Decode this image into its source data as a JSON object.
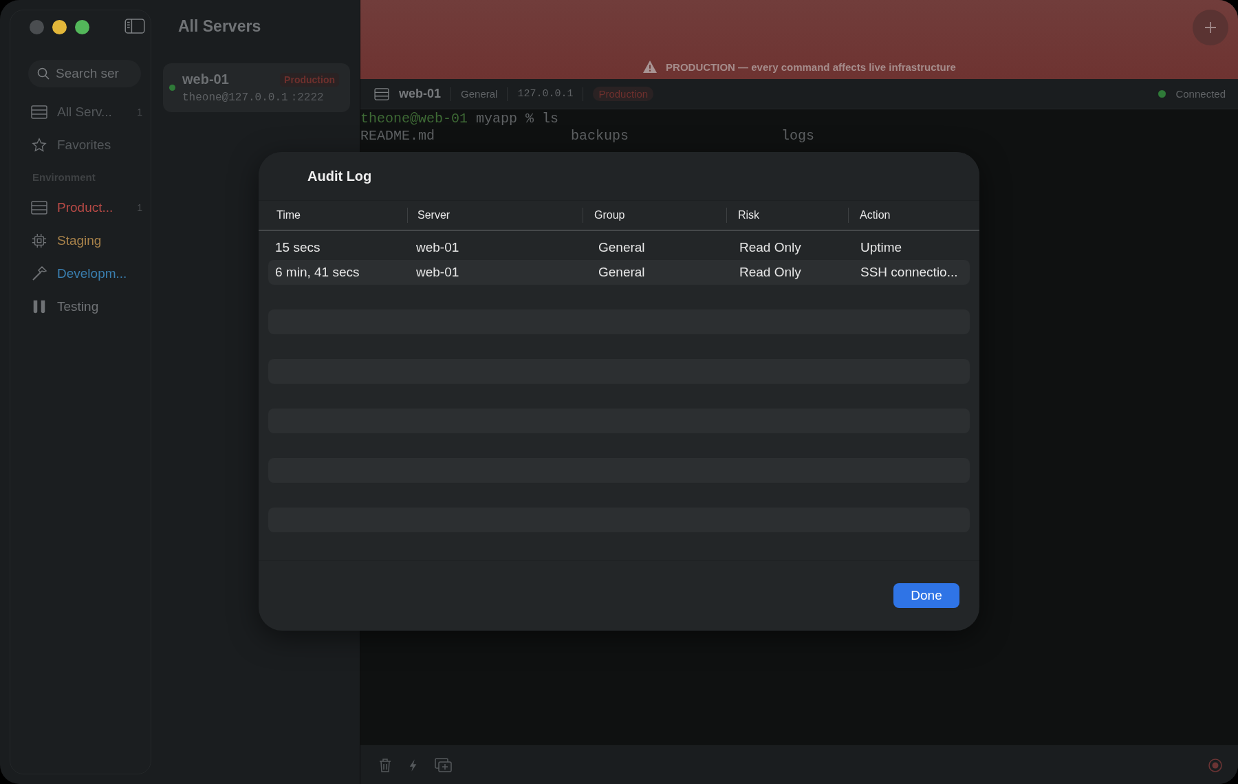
{
  "window": {
    "title": "All Servers"
  },
  "sidebar": {
    "search": {
      "placeholder": "Search ser"
    },
    "items": [
      {
        "label": "All Serv...",
        "count": "1"
      },
      {
        "label": "Favorites"
      }
    ],
    "section": "Environment",
    "environments": [
      {
        "label": "Product...",
        "count": "1",
        "color": "#b84a46"
      },
      {
        "label": "Staging",
        "color": "#a8824a"
      },
      {
        "label": "Developm...",
        "color": "#3a7fb0"
      },
      {
        "label": "Testing",
        "color": "#6f7275"
      }
    ]
  },
  "servers": [
    {
      "name": "web-01",
      "tag": "Production",
      "address": "theone@127.0.0.1",
      "port": ":2222",
      "online": true
    }
  ],
  "banner": {
    "text": "PRODUCTION — every command affects live infrastructure"
  },
  "session_bar": {
    "name": "web-01",
    "group": "General",
    "host": "127.0.0.1",
    "environment": "Production",
    "status": "Connected"
  },
  "terminal": {
    "prompt": "theone@web-01",
    "command": " myapp % ls",
    "output": [
      "README.md",
      "backups",
      "logs"
    ]
  },
  "dialog": {
    "title": "Audit Log",
    "columns": [
      "Time",
      "Server",
      "Group",
      "Risk",
      "Action"
    ],
    "rows": [
      [
        "15 secs",
        "web-01",
        "General",
        "Read Only",
        "Uptime"
      ],
      [
        "6 min, 41 secs",
        "web-01",
        "General",
        "Read Only",
        "SSH connectio..."
      ]
    ],
    "button": "Done"
  }
}
